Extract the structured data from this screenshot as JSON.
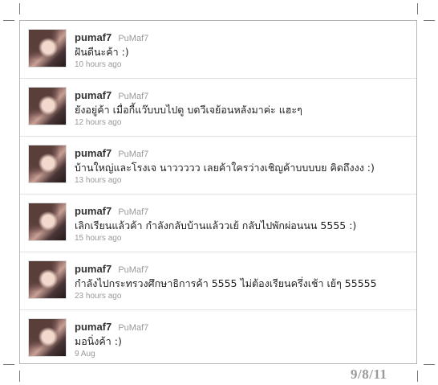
{
  "tweets": [
    {
      "username": "pumaf7",
      "handle": "PuMaf7",
      "text": "ฝันดีนะค้า :)",
      "time": "10 hours ago"
    },
    {
      "username": "pumaf7",
      "handle": "PuMaf7",
      "text": "ยังอยู่ค้า เมื่อกี้แว๊บบบไปดู บดวีเจย้อนหลังมาค่ะ แฮะๆ",
      "time": "12 hours ago"
    },
    {
      "username": "pumaf7",
      "handle": "PuMaf7",
      "text": "บ้านใหญ่และโรงเจ นาววววว เลยค้าใครว่างเชิญค้าบบบบย คิดถึงงง :)",
      "time": "13 hours ago"
    },
    {
      "username": "pumaf7",
      "handle": "PuMaf7",
      "text": "เลิกเรียนแล้วค้า กำลังกลับบ้านแล้ววเย้ กลับไปพักผ่อนนน 5555 :)",
      "time": "15 hours ago"
    },
    {
      "username": "pumaf7",
      "handle": "PuMaf7",
      "text": "กำลังไปกระทรวงศึกษาธิการค้า 5555 ไม่ต้องเรียนครึ่งเช้า เย้ๆ 55555",
      "time": "23 hours ago"
    },
    {
      "username": "pumaf7",
      "handle": "PuMaf7",
      "text": "มอนิ่งค้า :)",
      "time": "9 Aug"
    }
  ],
  "date_stamp": "9/8/11"
}
